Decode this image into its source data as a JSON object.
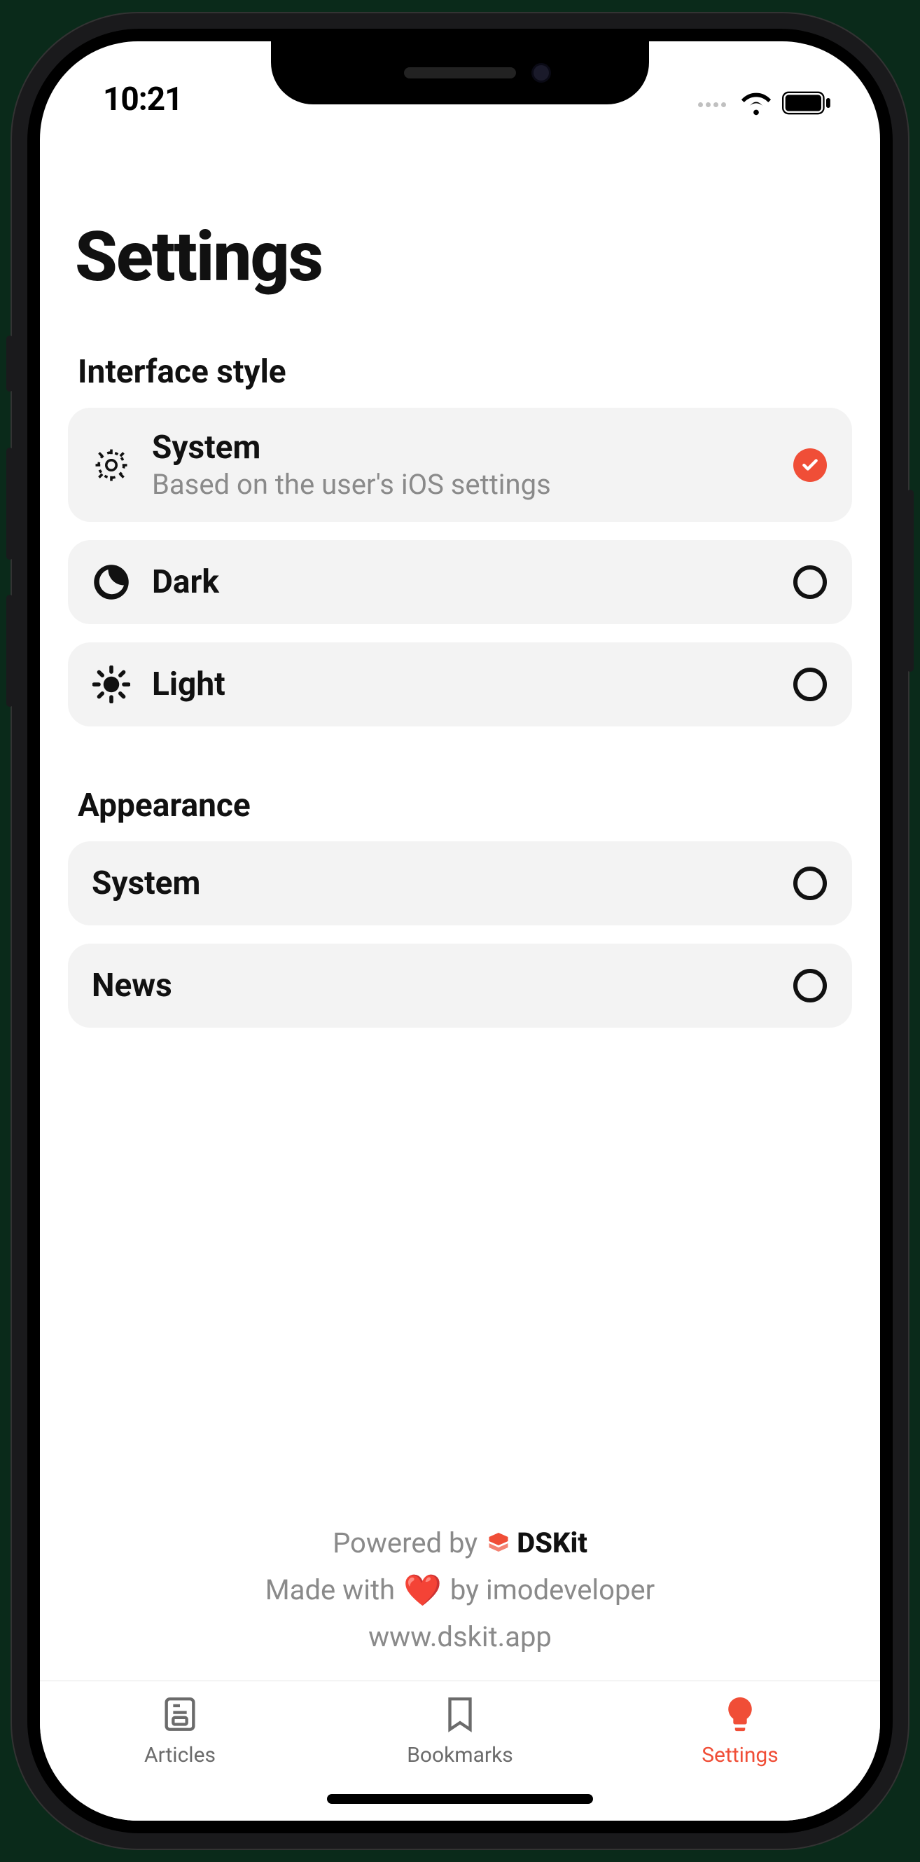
{
  "status": {
    "time": "10:21"
  },
  "page": {
    "title": "Settings"
  },
  "sections": {
    "interface": {
      "header": "Interface style",
      "options": [
        {
          "title": "System",
          "subtitle": "Based on the user's iOS settings",
          "selected": true
        },
        {
          "title": "Dark",
          "selected": false
        },
        {
          "title": "Light",
          "selected": false
        }
      ]
    },
    "appearance": {
      "header": "Appearance",
      "options": [
        {
          "title": "System",
          "selected": false
        },
        {
          "title": "News",
          "selected": false
        }
      ]
    }
  },
  "footer": {
    "powered_prefix": "Powered by",
    "brand": "DSKit",
    "made_prefix": "Made with",
    "made_suffix": "by imodeveloper",
    "url": "www.dskit.app"
  },
  "tabs": [
    {
      "label": "Articles",
      "active": false
    },
    {
      "label": "Bookmarks",
      "active": false
    },
    {
      "label": "Settings",
      "active": true
    }
  ],
  "colors": {
    "accent": "#f04e37"
  }
}
